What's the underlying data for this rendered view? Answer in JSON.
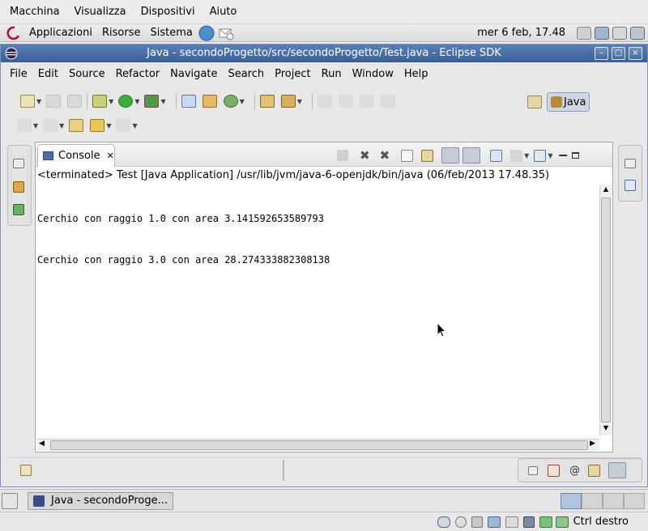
{
  "vbox_menu": [
    "Macchina",
    "Visualizza",
    "Dispositivi",
    "Aiuto"
  ],
  "panel": {
    "menus": [
      "Applicazioni",
      "Risorse",
      "Sistema"
    ],
    "clock": "mer  6 feb, 17.48"
  },
  "window": {
    "title": "Java - secondoProgetto/src/secondoProgetto/Test.java - Eclipse SDK",
    "minimize": "–",
    "maximize": "□",
    "close": "×"
  },
  "menubar": [
    "File",
    "Edit",
    "Source",
    "Refactor",
    "Navigate",
    "Search",
    "Project",
    "Run",
    "Window",
    "Help"
  ],
  "perspective": {
    "label": "Java"
  },
  "console": {
    "tab_label": "Console",
    "tab_close": "✕",
    "header": "<terminated> Test [Java Application] /usr/lib/jvm/java-6-openjdk/bin/java (06/feb/2013 17.48.35)",
    "lines": [
      "Cerchio con raggio 1.0 con area 3.141592653589793",
      "Cerchio con raggio 3.0 con area 28.274333882308138"
    ]
  },
  "taskbar": {
    "item": "Java - secondoProge..."
  },
  "statusbar": {
    "host_key": "Ctrl destro"
  },
  "colors": {
    "titlebar": "#3a5f97",
    "accent": "#5b7fb5"
  }
}
